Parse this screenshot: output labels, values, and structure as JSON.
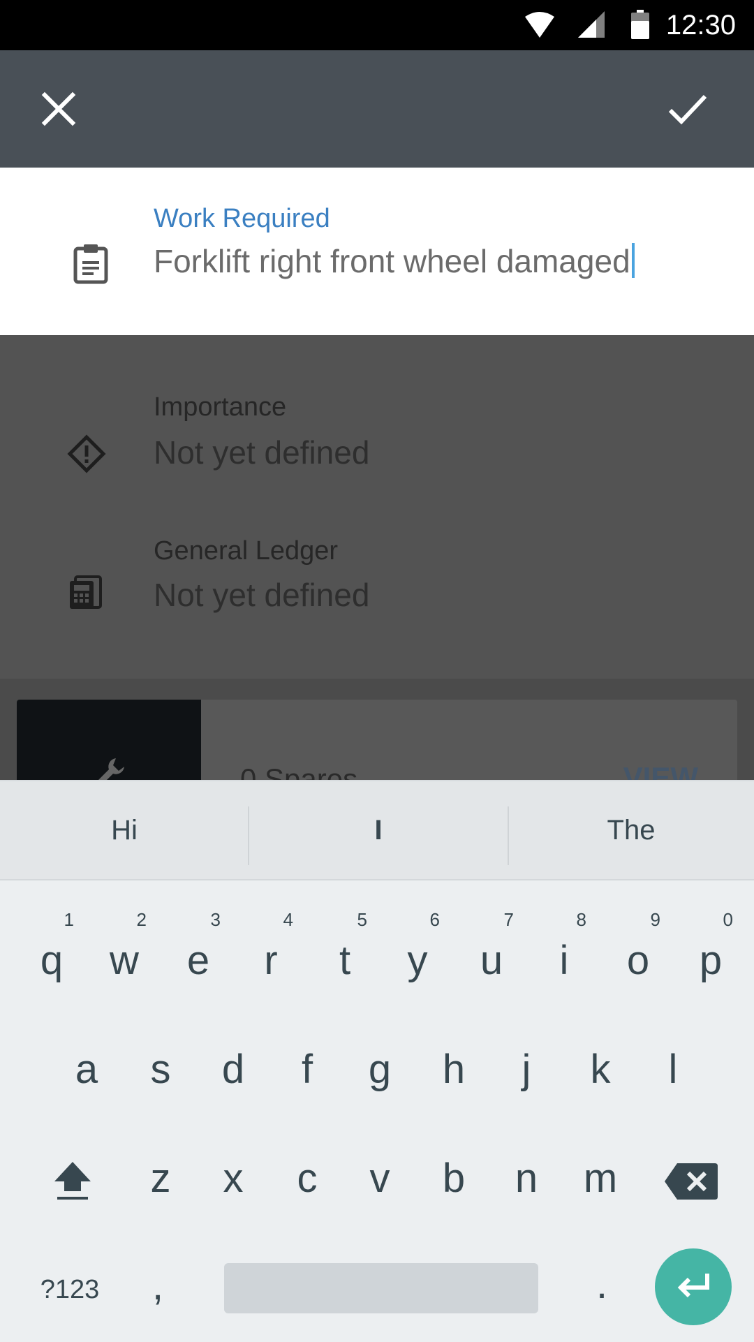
{
  "status_bar": {
    "time": "12:30"
  },
  "toolbar": {
    "close_icon": "close-icon",
    "confirm_icon": "check-icon"
  },
  "work_required": {
    "label": "Work Required",
    "value": "Forklift right front wheel damaged",
    "icon": "clipboard-icon",
    "label_color": "#3a7fc1"
  },
  "importance": {
    "label": "Importance",
    "value": "Not yet defined",
    "icon": "warning-diamond-icon"
  },
  "general_ledger": {
    "label": "General Ledger",
    "value": "Not yet defined",
    "icon": "ledger-calculator-icon"
  },
  "spares_card": {
    "title": "0 Spares",
    "action": "VIEW",
    "icon": "wrench-icon"
  },
  "keyboard": {
    "suggestions": [
      "Hi",
      "I",
      "The"
    ],
    "row1": [
      "q",
      "w",
      "e",
      "r",
      "t",
      "y",
      "u",
      "i",
      "o",
      "p"
    ],
    "row1_numbers": [
      "1",
      "2",
      "3",
      "4",
      "5",
      "6",
      "7",
      "8",
      "9",
      "0"
    ],
    "row2": [
      "a",
      "s",
      "d",
      "f",
      "g",
      "h",
      "j",
      "k",
      "l"
    ],
    "row3": [
      "z",
      "x",
      "c",
      "v",
      "b",
      "n",
      "m"
    ],
    "symbols_label": "?123",
    "comma": ",",
    "period": ".",
    "enter_color": "#45b5a5"
  }
}
